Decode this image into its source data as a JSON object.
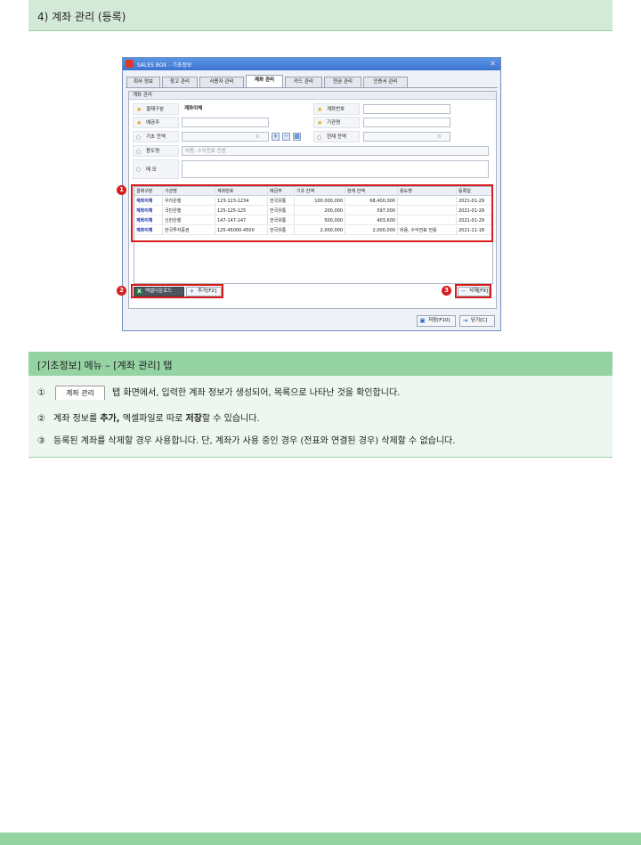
{
  "header": {
    "title": "4) 계좌 관리 (등록)"
  },
  "window": {
    "title": "SALES BOX - 기초정보",
    "tabs": [
      "회사 정보",
      "창고 관리",
      "사용자 관리",
      "계좌 관리",
      "카드 관리",
      "현금 관리",
      "인증서 관리"
    ],
    "active_tab": "계좌 관리",
    "panel_title": "계좌 관리",
    "form": {
      "type_label": "결제구분",
      "type_value": "계좌이체",
      "account_no_label": "계좌번호",
      "holder_label": "예금주",
      "bank_label": "기관명",
      "base_balance_label": "기초 잔액",
      "base_balance_value": "0",
      "current_balance_label": "현재 잔액",
      "current_balance_value": "0",
      "purpose_label": "용도명",
      "purpose_placeholder": "비용, 수익전표 전용",
      "memo_label": "메 모"
    },
    "grid": {
      "headers": [
        "결제구분",
        "기관명",
        "계좌번호",
        "예금주",
        "기초 잔액",
        "현재 잔액",
        "용도명",
        "등록일"
      ],
      "rows": [
        [
          "계좌이체",
          "우리은행",
          "123-123-1234",
          "한국유통",
          "100,000,000",
          "68,400,000",
          "",
          "2021-01-29"
        ],
        [
          "계좌이체",
          "국민은행",
          "125-125-125",
          "한국유통",
          "200,000",
          "597,000",
          "",
          "2021-01-29"
        ],
        [
          "계좌이체",
          "신한은행",
          "147-147-147",
          "한국유통",
          "500,000",
          "403,600",
          "",
          "2021-01-29"
        ],
        [
          "계좌이체",
          "한국투자증권",
          "125-45000-4500",
          "한국유통",
          "2,000,000",
          "2,000,000",
          "비용, 수익전표 전용",
          "2021-11-18"
        ]
      ]
    },
    "buttons": {
      "excel": "엑셀다운로드",
      "add": "추가[F2]",
      "delete": "삭제[F9]",
      "save": "저장[F10]",
      "close": "닫기[C]"
    },
    "badges": [
      "1",
      "2",
      "3"
    ]
  },
  "section": {
    "title": "[기초정보] 메뉴 – [계좌 관리] 탭",
    "tab_chip": "계좌 관리",
    "items": [
      {
        "num": "①",
        "text": "탭 화면에서, 입력한 계좌 정보가 생성되어, 목록으로 나타난 것을 확인합니다."
      },
      {
        "num": "②",
        "text_a": "계좌 정보를 ",
        "bold_a": "추가,",
        "text_b": " 엑셀파일로 따로 ",
        "bold_b": "저장",
        "text_c": "할 수 있습니다."
      },
      {
        "num": "③",
        "text": "등록된 계좌를 삭제할 경우 사용합니다. 단, 계좌가 사용 중인 경우 (전표와 연결된 경우) 삭제할 수 없습니다."
      }
    ]
  },
  "colors": {
    "accent_green": "#95d3a3",
    "highlight_red": "#d91c1c",
    "kind_blue": "#1e2fa8"
  }
}
